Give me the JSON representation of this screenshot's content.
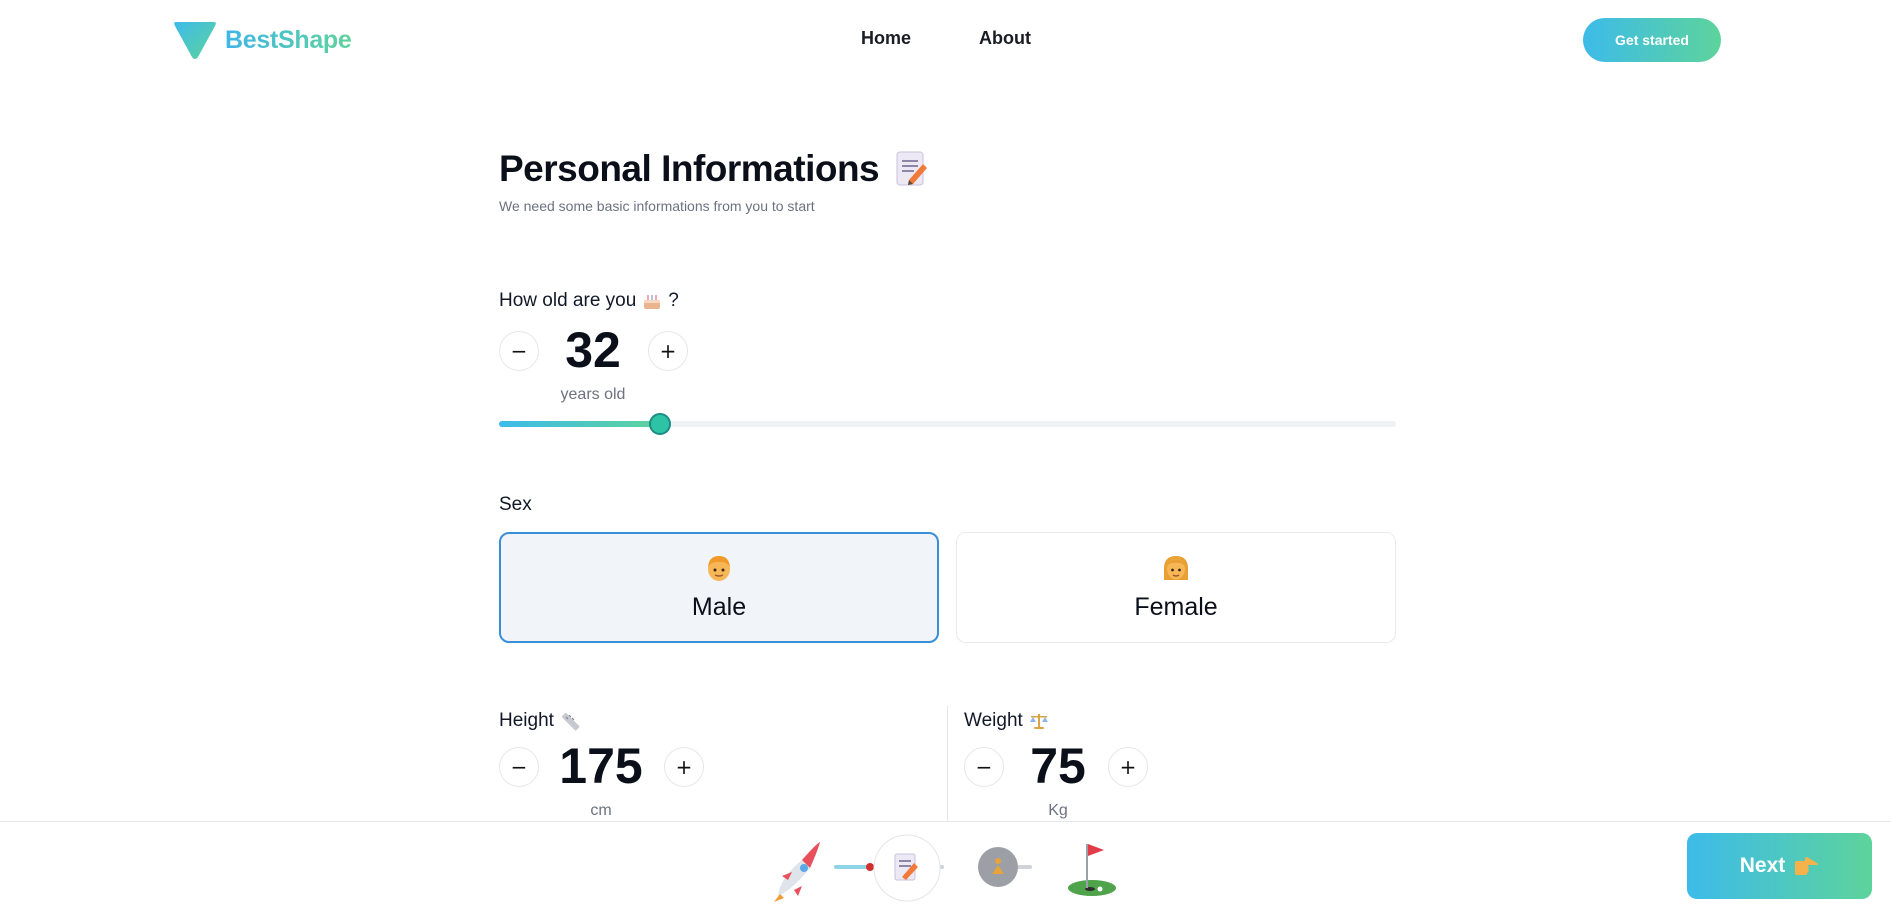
{
  "header": {
    "brand": "BestShape",
    "nav": [
      {
        "label": "Home"
      },
      {
        "label": "About"
      }
    ],
    "cta_label": "Get started"
  },
  "page": {
    "title": "Personal Informations",
    "subtitle": "We need some basic informations from you to start"
  },
  "age": {
    "label": "How old are you",
    "label_suffix": "?",
    "value": "32",
    "unit": "years old",
    "slider_fraction": 0.18,
    "decrement": "−",
    "increment": "+"
  },
  "sex": {
    "label": "Sex",
    "options": [
      {
        "label": "Male",
        "selected": true
      },
      {
        "label": "Female",
        "selected": false
      }
    ]
  },
  "height": {
    "label": "Height",
    "value": "175",
    "unit": "cm",
    "decrement": "−",
    "increment": "+"
  },
  "weight": {
    "label": "Weight",
    "value": "75",
    "unit": "Kg",
    "decrement": "−",
    "increment": "+"
  },
  "footer": {
    "next_label": "Next",
    "progress_steps": [
      {
        "icon": "rocket-icon",
        "state": "done"
      },
      {
        "icon": "memo-icon",
        "state": "current"
      },
      {
        "icon": "person-icon",
        "state": "upcoming"
      },
      {
        "icon": "golf-flag-icon",
        "state": "upcoming"
      }
    ]
  },
  "colors": {
    "accent_start": "#3dbbe9",
    "accent_end": "#5dd39c",
    "selected_border": "#3b8fd6"
  }
}
